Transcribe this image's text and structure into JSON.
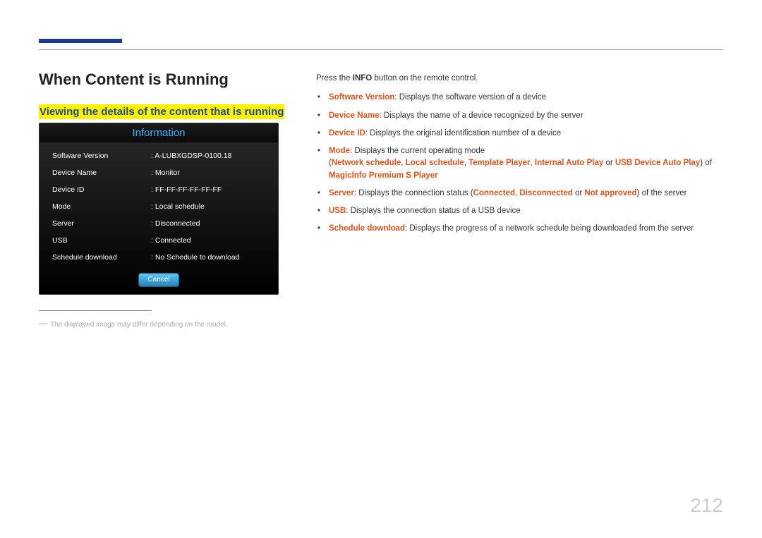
{
  "page_number": "212",
  "section_title": "When Content is Running",
  "subsection_title": "Viewing the details of the content that is running",
  "info_panel": {
    "title": "Information",
    "rows": [
      {
        "label": "Software Version",
        "value": ": A-LUBXGDSP-0100.18"
      },
      {
        "label": "Device Name",
        "value": ": Monitor"
      },
      {
        "label": "Device ID",
        "value": ": FF-FF-FF-FF-FF-FF"
      },
      {
        "label": "Mode",
        "value": ": Local schedule"
      },
      {
        "label": "Server",
        "value": ": Disconnected"
      },
      {
        "label": "USB",
        "value": ": Connected"
      },
      {
        "label": "Schedule download",
        "value": ": No Schedule to download"
      }
    ],
    "cancel_label": "Cancel"
  },
  "footnote": "The displayed image may differ depending on the model.",
  "intro": {
    "pre": "Press the ",
    "bold": "INFO",
    "post": " button on the remote control."
  },
  "bullets": {
    "sv_label": "Software Version",
    "sv_desc": ": Displays the software version of a device",
    "dn_label": "Device Name",
    "dn_desc": ": Displays the name of a device recognized by the server",
    "di_label": "Device ID",
    "di_desc": ": Displays the original identification number of a device",
    "mode_label": "Mode",
    "mode_desc": ": Displays the current operating mode",
    "mode_paren_open": "(",
    "mode_opt1": "Network schedule",
    "mode_sep": ", ",
    "mode_opt2": "Local schedule",
    "mode_opt3": "Template Player",
    "mode_opt4": "Internal Auto Play",
    "mode_or": " or ",
    "mode_opt5": "USB Device Auto Play",
    "mode_of": ") of ",
    "mode_product": "MagicInfo Premium S Player",
    "server_label": "Server",
    "server_desc_pre": ": Displays the connection status (",
    "server_opt1": "Connected",
    "server_opt2": "Disconnected",
    "server_opt3": "Not approved",
    "server_desc_post": ") of the server",
    "usb_label": "USB",
    "usb_desc": ": Displays the connection status of a USB device",
    "sd_label": "Schedule download",
    "sd_desc": ": Displays the progress of a network schedule being downloaded from the server"
  }
}
